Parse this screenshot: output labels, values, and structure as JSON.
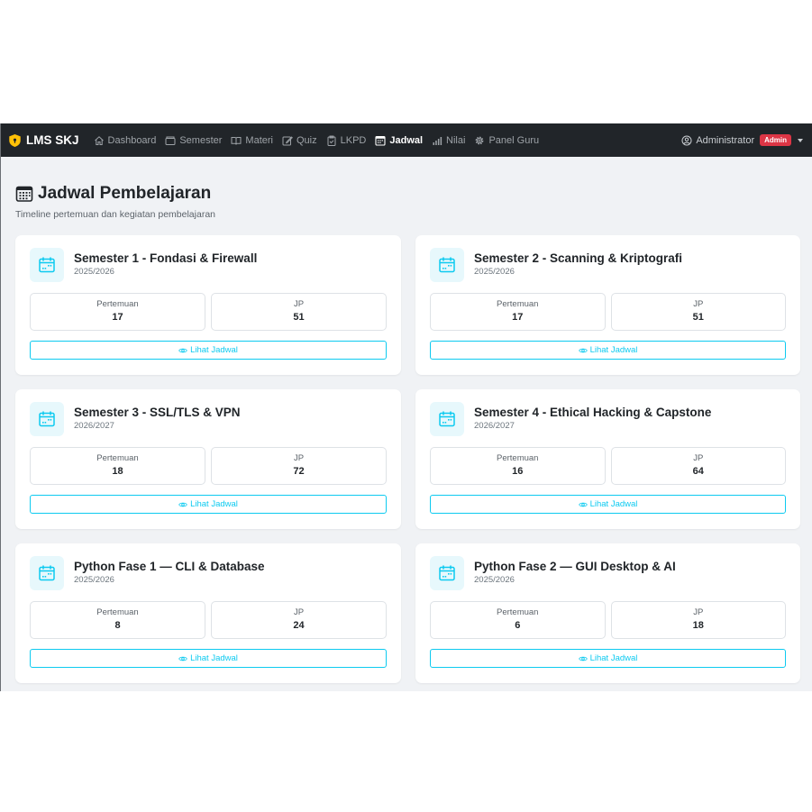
{
  "navbar": {
    "brand": "LMS SKJ",
    "items": [
      {
        "label": "Dashboard",
        "icon": "house-icon",
        "active": false
      },
      {
        "label": "Semester",
        "icon": "folder-icon",
        "active": false
      },
      {
        "label": "Materi",
        "icon": "book-icon",
        "active": false
      },
      {
        "label": "Quiz",
        "icon": "edit-icon",
        "active": false
      },
      {
        "label": "LKPD",
        "icon": "clipboard-check-icon",
        "active": false
      },
      {
        "label": "Jadwal",
        "icon": "calendar-icon",
        "active": true
      },
      {
        "label": "Nilai",
        "icon": "bar-chart-icon",
        "active": false
      },
      {
        "label": "Panel Guru",
        "icon": "gear-icon",
        "active": false
      }
    ],
    "user": {
      "name": "Administrator",
      "badge": "Admin",
      "icon": "user-circle-icon"
    }
  },
  "header": {
    "title": "Jadwal Pembelajaran",
    "subtitle": "Timeline pertemuan dan kegiatan pembelajaran",
    "icon": "calendar-grid-icon"
  },
  "colors": {
    "accent": "#0dcaf0",
    "navbar": "#212529",
    "badge": "#dc3545",
    "background": "#f0f2f5"
  },
  "cards": [
    {
      "title": "Semester 1 - Fondasi & Firewall",
      "year": "2025/2026",
      "meetings_label": "Pertemuan",
      "meetings": "17",
      "jp_label": "JP",
      "jp": "51",
      "button": "Lihat Jadwal"
    },
    {
      "title": "Semester 2 - Scanning & Kriptografi",
      "year": "2025/2026",
      "meetings_label": "Pertemuan",
      "meetings": "17",
      "jp_label": "JP",
      "jp": "51",
      "button": "Lihat Jadwal"
    },
    {
      "title": "Semester 3 - SSL/TLS & VPN",
      "year": "2026/2027",
      "meetings_label": "Pertemuan",
      "meetings": "18",
      "jp_label": "JP",
      "jp": "72",
      "button": "Lihat Jadwal"
    },
    {
      "title": "Semester 4 - Ethical Hacking & Capstone",
      "year": "2026/2027",
      "meetings_label": "Pertemuan",
      "meetings": "16",
      "jp_label": "JP",
      "jp": "64",
      "button": "Lihat Jadwal"
    },
    {
      "title": "Python Fase 1 — CLI & Database",
      "year": "2025/2026",
      "meetings_label": "Pertemuan",
      "meetings": "8",
      "jp_label": "JP",
      "jp": "24",
      "button": "Lihat Jadwal"
    },
    {
      "title": "Python Fase 2 — GUI Desktop & AI",
      "year": "2025/2026",
      "meetings_label": "Pertemuan",
      "meetings": "6",
      "jp_label": "JP",
      "jp": "18",
      "button": "Lihat Jadwal"
    }
  ]
}
